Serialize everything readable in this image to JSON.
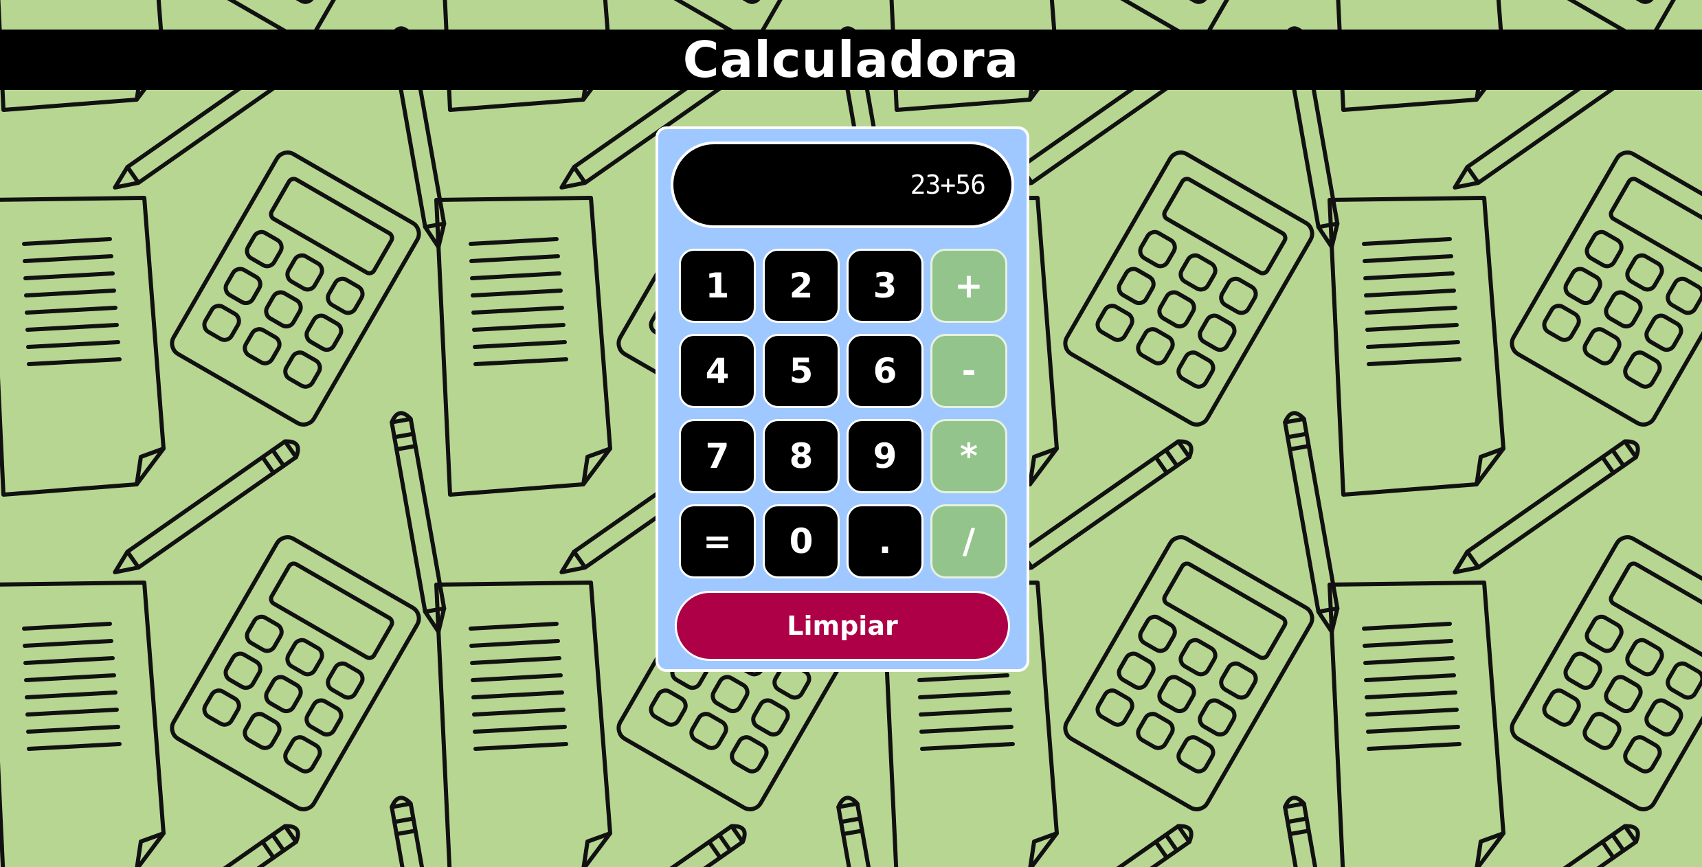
{
  "header": {
    "title": "Calculadora"
  },
  "calculator": {
    "display": "23+56",
    "keys": [
      "1",
      "2",
      "3",
      "+",
      "4",
      "5",
      "6",
      "-",
      "7",
      "8",
      "9",
      "*",
      "=",
      "0",
      ".",
      "/"
    ],
    "clear_label": "Limpiar"
  },
  "colors": {
    "background": "#b7d692",
    "header": "#000000",
    "panel": "#9ec8ff",
    "number_key": "#000000",
    "operator_key": "#93c48b",
    "clear_button": "#ad0046"
  },
  "background_pattern": {
    "icons": [
      "document-icon",
      "calculator-icon",
      "pencil-icon"
    ]
  }
}
